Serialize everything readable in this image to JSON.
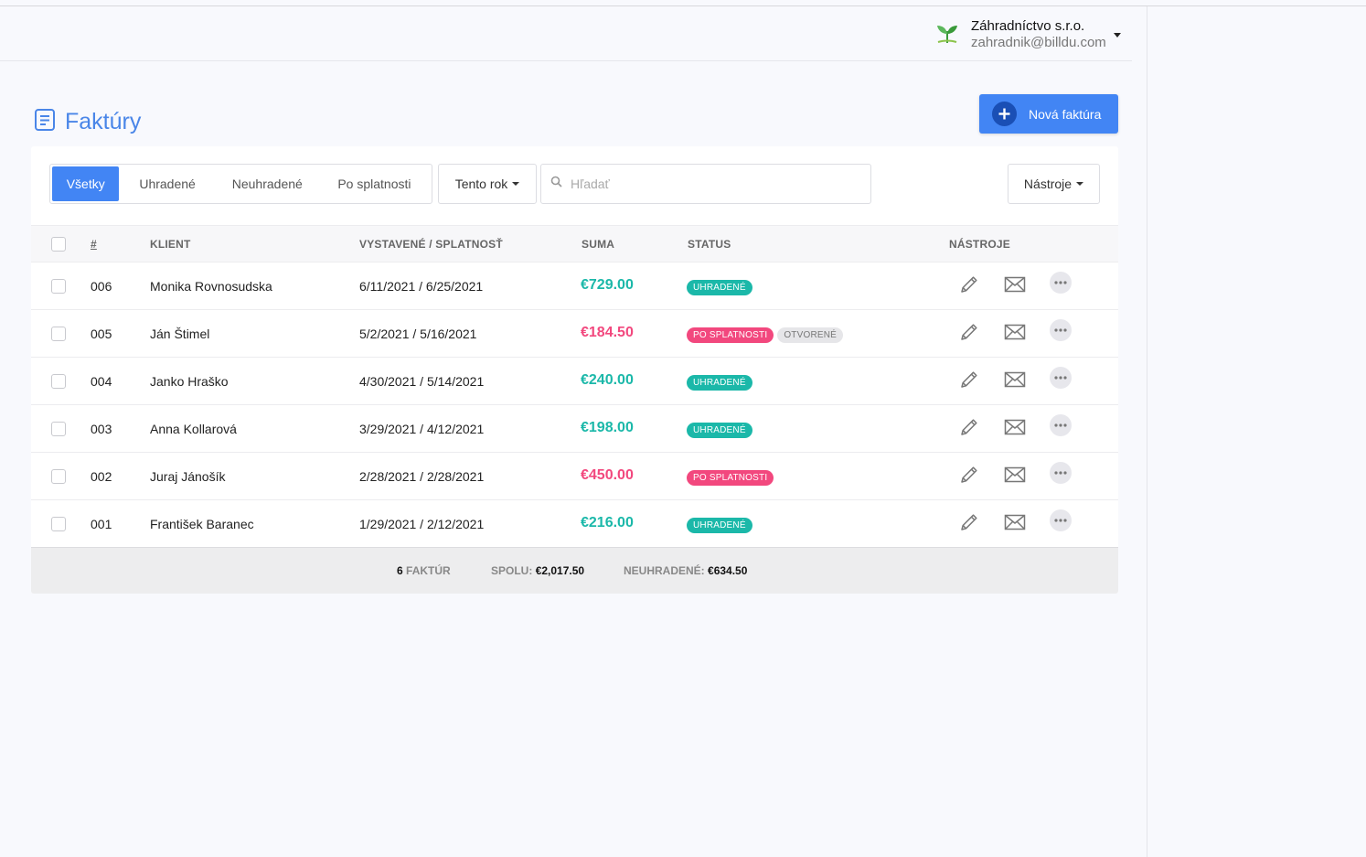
{
  "account": {
    "company": "Záhradníctvo s.r.o.",
    "email": "zahradnik@billdu.com",
    "logo_icon": "sprout-logo"
  },
  "page": {
    "title": "Faktúry",
    "title_icon": "document-icon",
    "new_button": "Nová faktúra"
  },
  "filters": {
    "tabs": [
      "Všetky",
      "Uhradené",
      "Neuhradené",
      "Po splatnosti"
    ],
    "active_tab": 0,
    "period": "Tento rok",
    "search_placeholder": "Hľadať",
    "tools": "Nástroje"
  },
  "table": {
    "headers": {
      "number": "#",
      "client": "KLIENT",
      "dates": "VYSTAVENÉ / SPLATNOSŤ",
      "amount": "SUMA",
      "status": "STATUS",
      "tools": "NÁSTROJE"
    },
    "rows": [
      {
        "number": "006",
        "client": "Monika Rovnosudska",
        "dates": "6/11/2021 / 6/25/2021",
        "amount": "€729.00",
        "paid": true,
        "statuses": [
          {
            "label": "Uhradené",
            "color": "#1bb8a9"
          }
        ]
      },
      {
        "number": "005",
        "client": "Ján Štimel",
        "dates": "5/2/2021 / 5/16/2021",
        "amount": "€184.50",
        "paid": false,
        "statuses": [
          {
            "label": "Po splatnosti",
            "color": "#f2487e"
          },
          {
            "label": "Otvorené",
            "color": "#e6e6e9",
            "text": "#777"
          }
        ]
      },
      {
        "number": "004",
        "client": "Janko Hraško",
        "dates": "4/30/2021 / 5/14/2021",
        "amount": "€240.00",
        "paid": true,
        "statuses": [
          {
            "label": "Uhradené",
            "color": "#1bb8a9"
          }
        ]
      },
      {
        "number": "003",
        "client": "Anna Kollarová",
        "dates": "3/29/2021 / 4/12/2021",
        "amount": "€198.00",
        "paid": true,
        "statuses": [
          {
            "label": "Uhradené",
            "color": "#1bb8a9"
          }
        ]
      },
      {
        "number": "002",
        "client": "Juraj Jánošík",
        "dates": "2/28/2021 / 2/28/2021",
        "amount": "€450.00",
        "paid": false,
        "statuses": [
          {
            "label": "Po splatnosti",
            "color": "#f2487e"
          }
        ]
      },
      {
        "number": "001",
        "client": "František Baranec",
        "dates": "1/29/2021 / 2/12/2021",
        "amount": "€216.00",
        "paid": true,
        "statuses": [
          {
            "label": "Uhradené",
            "color": "#1bb8a9"
          }
        ]
      }
    ]
  },
  "footer": {
    "count_value": "6",
    "count_label": "FAKTÚR",
    "total_label": "SPOLU:",
    "total_value": "€2,017.50",
    "unpaid_label": "NEUHRADENÉ:",
    "unpaid_value": "€634.50"
  },
  "colors": {
    "accent": "#4285f4",
    "paid": "#1bb8a9",
    "overdue": "#f2487e",
    "title": "#4a86e8"
  }
}
